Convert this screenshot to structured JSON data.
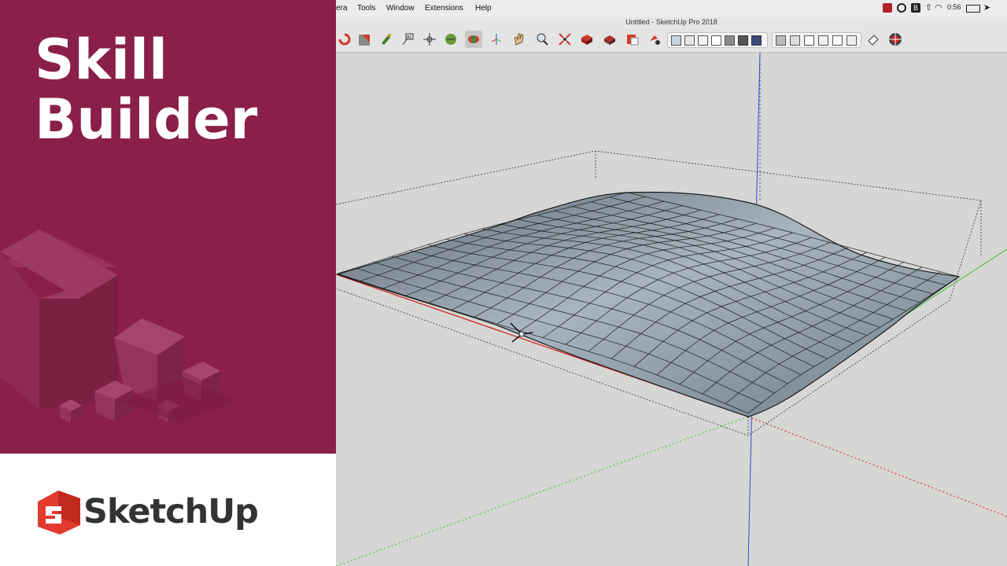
{
  "brand": {
    "title_line1": "Skill",
    "title_line2": "Builder",
    "logo_text": "SketchUp",
    "panel_color": "#8a1f48",
    "logo_color": "#e33a2e"
  },
  "menubar": {
    "items": [
      "era",
      "Tools",
      "Window",
      "Extensions",
      "Help"
    ],
    "clock": "0:56"
  },
  "window": {
    "title": "Untitled - SketchUp Pro 2018"
  },
  "toolbar": {
    "tools": [
      "orbit-icon",
      "section-plane-icon",
      "paint-bucket-icon",
      "dimension-text-icon",
      "axes-icon",
      "position-camera-icon",
      "walk-icon",
      "look-around-icon",
      "zoom-icon",
      "zoom-extents-icon",
      "warehouse-icon",
      "extension-warehouse-icon",
      "layout-icon",
      "style-builder-icon"
    ],
    "active_tool": "look-around-icon",
    "view_styles": [
      "xray-icon",
      "back-edges-icon",
      "wireframe-icon",
      "hidden-line-icon",
      "shaded-icon",
      "shaded-textures-icon",
      "monochrome-icon"
    ],
    "camera_views": [
      "iso-view-icon",
      "top-view-icon",
      "front-view-icon",
      "right-view-icon",
      "back-view-icon",
      "left-view-icon"
    ]
  },
  "scene": {
    "model": "terrain-mesh",
    "axis_colors": {
      "red": "#d11e1e",
      "green": "#3bbf2a",
      "blue": "#2a4fd1"
    },
    "surface_color": "#7d8a96"
  }
}
